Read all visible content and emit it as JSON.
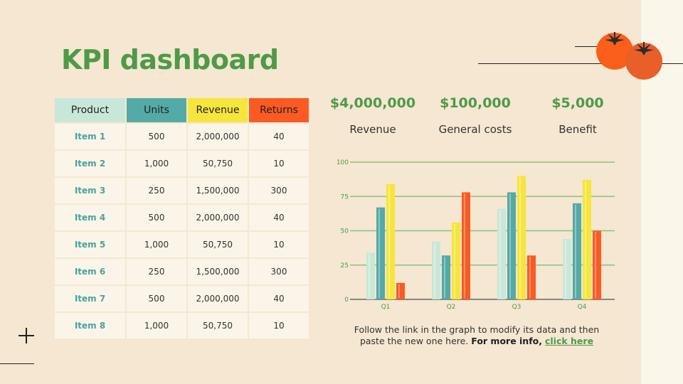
{
  "slide": {
    "title": "KPI dashboard"
  },
  "table": {
    "headers": [
      "Product",
      "Units",
      "Revenue",
      "Returns"
    ],
    "rows": [
      [
        "Item 1",
        "500",
        "2,000,000",
        "40"
      ],
      [
        "Item 2",
        "1,000",
        "50,750",
        "10"
      ],
      [
        "Item 3",
        "250",
        "1,500,000",
        "300"
      ],
      [
        "Item 4",
        "500",
        "2,000,000",
        "40"
      ],
      [
        "Item 5",
        "1,000",
        "50,750",
        "10"
      ],
      [
        "Item 6",
        "250",
        "1,500,000",
        "300"
      ],
      [
        "Item 7",
        "500",
        "2,000,000",
        "40"
      ],
      [
        "Item 8",
        "1,000",
        "50,750",
        "10"
      ]
    ]
  },
  "stats": [
    {
      "value": "$4,000,000",
      "label": "Revenue"
    },
    {
      "value": "$100,000",
      "label": "General costs"
    },
    {
      "value": "$5,000",
      "label": "Benefit"
    }
  ],
  "note": {
    "text": "Follow the link in the graph to modify its data and then paste the new one here.",
    "bold": "For more info,",
    "link": "click here"
  },
  "colors": {
    "accent": "#4e9a48",
    "mint": "#c9e7d8",
    "teal": "#54aaa6",
    "yellow": "#f6e53c",
    "orange": "#fb5a23"
  },
  "decorations": {
    "icon": "tomato-icon"
  },
  "chart_data": {
    "type": "bar",
    "categories": [
      "Q1",
      "Q2",
      "Q3",
      "Q4"
    ],
    "series": [
      {
        "values": [
          34,
          42,
          66,
          44
        ],
        "color": "#c9e7d8"
      },
      {
        "values": [
          67,
          32,
          78,
          70
        ],
        "color": "#54aaa6"
      },
      {
        "values": [
          84,
          56,
          90,
          87
        ],
        "color": "#f6e53c"
      },
      {
        "values": [
          12,
          78,
          32,
          50
        ],
        "color": "#fb5a23"
      }
    ],
    "yticks": [
      0,
      25,
      50,
      75,
      100
    ],
    "ylim": [
      0,
      100
    ],
    "grid": true,
    "legend": false
  }
}
